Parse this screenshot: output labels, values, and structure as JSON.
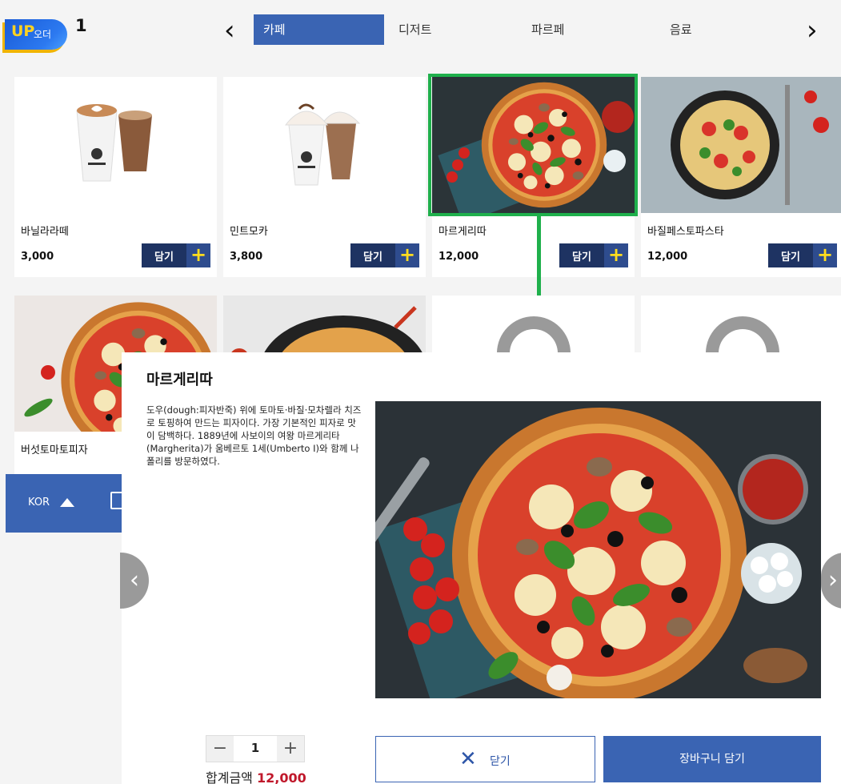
{
  "header": {
    "logo_up": "UP",
    "logo_order": "오더",
    "table_number": "1",
    "prev_icon": "chevron-left-icon",
    "next_icon": "chevron-right-icon",
    "tabs": [
      {
        "label": "카페",
        "active": true
      },
      {
        "label": "디저트",
        "active": false
      },
      {
        "label": "파르페",
        "active": false
      },
      {
        "label": "음료",
        "active": false
      }
    ]
  },
  "products": [
    {
      "name": "바닐라라떼",
      "price": "3,000",
      "add_label": "담기",
      "image": "latte-cups"
    },
    {
      "name": "민트모카",
      "price": "3,800",
      "add_label": "담기",
      "image": "mocha-cups"
    },
    {
      "name": "마르게리따",
      "price": "12,000",
      "add_label": "담기",
      "image": "margherita-pizza"
    },
    {
      "name": "바질페스토파스타",
      "price": "12,000",
      "add_label": "담기",
      "image": "basil-pasta"
    },
    {
      "name": "버섯토마토피자",
      "image": "mushroom-pizza"
    },
    {
      "image": "skillet-pizza"
    },
    {
      "image": "placeholder-icon"
    },
    {
      "image": "placeholder-icon"
    }
  ],
  "language_bar": {
    "label": "KOR",
    "icon": "caret-up-icon",
    "clipboard_icon": "clipboard-icon"
  },
  "detail": {
    "title": "마르게리따",
    "description": "도우(dough:피자반죽) 위에 토마토·바질·모차렐라 치즈로 토핑하여 만드는 피자이다. 가장 기본적인 피자로 맛이 담백하다. 1889년에 사보이의 여왕 마르게리타(Margherita)가 움베르토 1세(Umberto I)와 함께 나폴리를 방문하였다.",
    "quantity": "1",
    "total_label": "합계금액",
    "total_amount": "12,000",
    "close_label": "닫기",
    "cart_label": "장바구니 담기"
  },
  "colors": {
    "accent": "#3a64b3",
    "dark_navy": "#1e3362",
    "highlight_green": "#1fb04c",
    "price_red": "#c0182b",
    "plus_yellow": "#ffdc1e"
  }
}
